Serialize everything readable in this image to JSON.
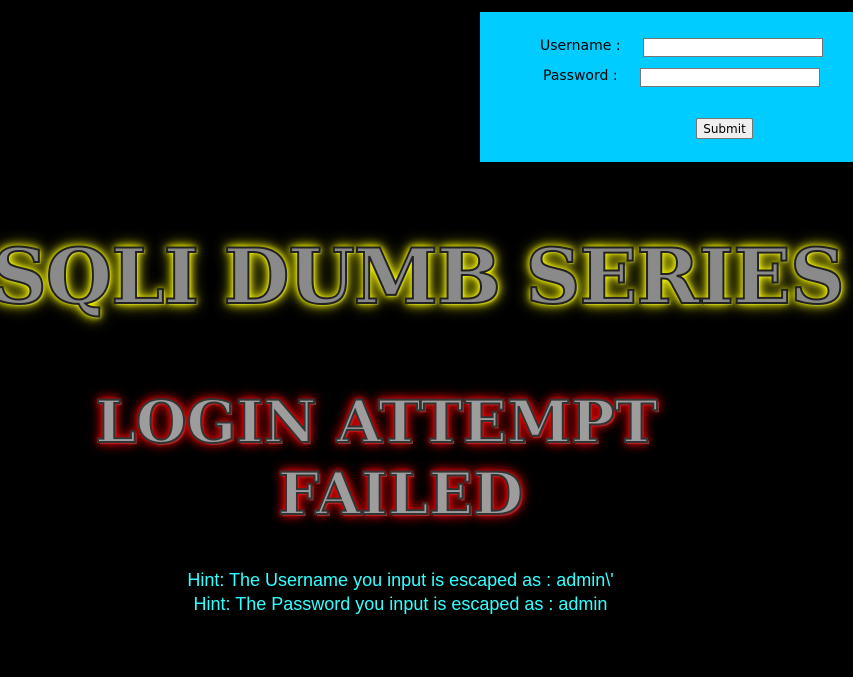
{
  "login_form": {
    "username_label": "Username :",
    "password_label": "Password :",
    "username_value": "",
    "password_value": "",
    "submit_label": "Submit",
    "panel_color": "#00CCFF"
  },
  "banner": {
    "title": "SQLI DUMB SERIES",
    "glow_color": "#FFFF00"
  },
  "result": {
    "line1": "LOGIN ATTEMPT",
    "line2": "FAILED",
    "glow_color": "#FF0000"
  },
  "hints": {
    "username": "Hint: The Username you input is escaped as : admin\\'",
    "password": "Hint: The Password you input is escaped as : admin",
    "color": "#33FFFF"
  },
  "page": {
    "background": "#000000"
  }
}
